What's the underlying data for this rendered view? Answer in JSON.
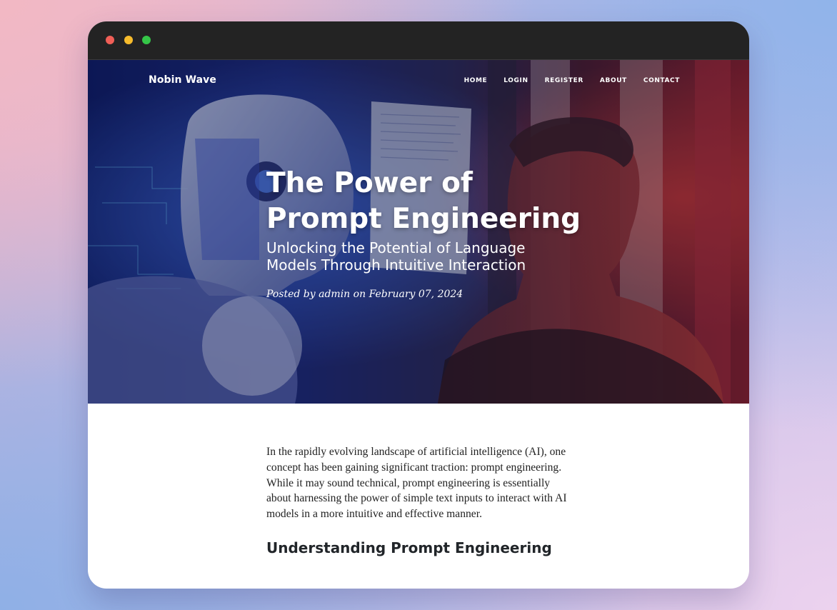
{
  "window": {
    "controls": [
      "close",
      "minimize",
      "maximize"
    ]
  },
  "site": {
    "brand": "Nobin Wave",
    "nav": [
      "HOME",
      "LOGIN",
      "REGISTER",
      "ABOUT",
      "CONTACT"
    ]
  },
  "post": {
    "title_line1": "The Power of",
    "title_line2": "Prompt Engineering",
    "subtitle": "Unlocking the Potential of Language Models Through Intuitive Interaction",
    "meta_prefix": "Posted by ",
    "author": "admin",
    "meta_middle": " on ",
    "date": "February 07, 2024",
    "body": [
      "In the rapidly evolving landscape of artificial intelligence (AI), one concept has been gaining significant traction: prompt engineering. While it may sound technical, prompt engineering is essentially about harnessing the power of simple text inputs to interact with AI models in a more intuitive and effective manner."
    ],
    "section_heading": "Understanding Prompt Engineering"
  },
  "colors": {
    "titlebar": "#232323",
    "close": "#f05f57",
    "minimize": "#f6bb2c",
    "maximize": "#35c648",
    "hero_blue": "#1b2a7e",
    "hero_red": "#8a2030"
  }
}
